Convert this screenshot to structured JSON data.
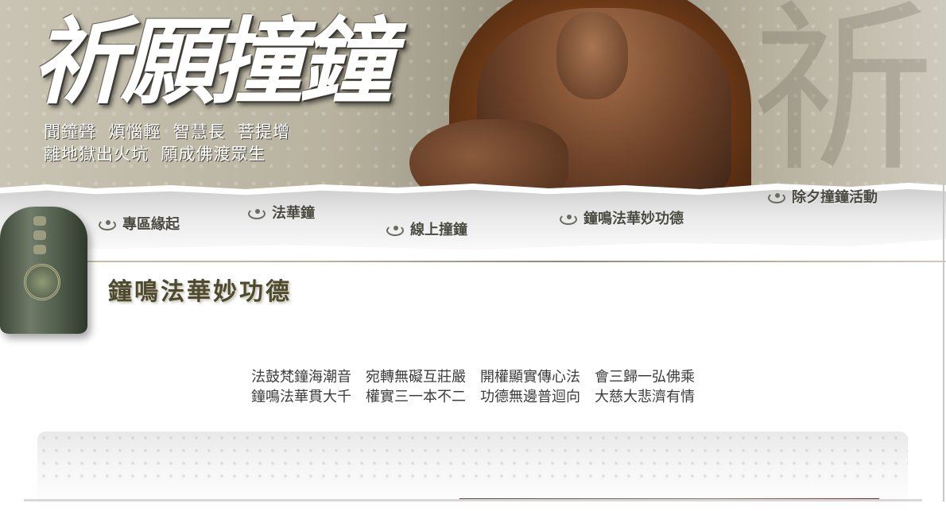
{
  "header": {
    "title": "祈願撞鐘",
    "subtitle_lines": [
      "聞鐘聲  煩惱輕  智慧長  菩提增",
      "離地獄出火坑  願成佛渡眾生"
    ]
  },
  "nav": {
    "items": [
      {
        "label": "專區緣起",
        "icon": "cloud-swirl-icon"
      },
      {
        "label": "法華鐘",
        "icon": "cloud-swirl-icon"
      },
      {
        "label": "線上撞鐘",
        "icon": "cloud-swirl-icon"
      },
      {
        "label": "鐘鳴法華妙功德",
        "icon": "cloud-swirl-icon"
      },
      {
        "label": "除夕撞鐘活動",
        "icon": "cloud-swirl-icon"
      }
    ]
  },
  "page": {
    "heading": "鐘鳴法華妙功德",
    "verse_lines": [
      "法鼓梵鐘海潮音　宛轉無礙互莊嚴　開權顯實傳心法　會三歸一弘佛乘",
      "鐘鳴法華貫大千　權實三一本不二　功德無邊普迴向　大慈大悲濟有情"
    ]
  },
  "colors": {
    "nav_text": "#4a4a42",
    "heading": "#4e4a2f",
    "verse_text": "#3c3c3c"
  }
}
